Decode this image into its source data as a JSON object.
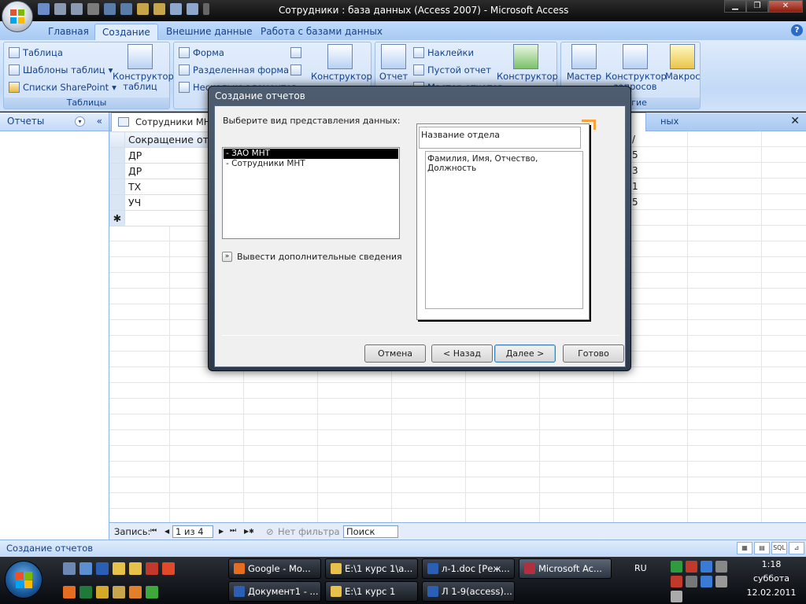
{
  "window": {
    "title": "Сотрудники : база данных (Access 2007) - Microsoft Access",
    "min_label": "▁",
    "max_label": "❐",
    "close_label": "✕"
  },
  "ribbon": {
    "tabs": [
      "Главная",
      "Создание",
      "Внешние данные",
      "Работа с базами данных"
    ],
    "active_tab": "Создание",
    "help_label": "?",
    "tables_group": {
      "title": "Таблицы",
      "table": "Таблица",
      "templates": "Шаблоны таблиц",
      "sharepoint": "Списки SharePoint",
      "designer_line1": "Конструктор",
      "designer_line2": "таблиц"
    },
    "forms_group": {
      "form": "Форма",
      "split_form": "Разделенная форма",
      "multi_items": "Несколько элементов",
      "designer": "Конструктор"
    },
    "reports_group": {
      "report": "Отчет",
      "labels": "Наклейки",
      "blank_report": "Пустой отчет",
      "wizard": "Мастер отчетов",
      "designer": "Конструктор"
    },
    "other_group": {
      "title": "Другие",
      "wizard": "Мастер",
      "query_designer_line1": "Конструктор",
      "query_designer_line2": "запросов",
      "macro": "Макрос"
    }
  },
  "nav": {
    "title": "Отчеты",
    "dropdown": "▾",
    "collapse": "«"
  },
  "document": {
    "tab_title": "Сотрудники МНТ",
    "right_tab_fragment": "ных",
    "close": "✕",
    "column_header": "Сокращение от",
    "rows": [
      "ДР",
      "ДР",
      "ТХ",
      "УЧ"
    ],
    "new_row_marker": "✱",
    "right_digits": [
      "5",
      "3",
      "1",
      "5"
    ],
    "right_header_fragment": "/"
  },
  "record_nav": {
    "label": "Запись:",
    "first": "⏮",
    "prev": "◀",
    "position": "1 из 4",
    "next": "▶",
    "last": "⏭",
    "new": "▶✱",
    "filter": "Нет фильтра",
    "search_placeholder": "Поиск"
  },
  "status": {
    "text": "Создание отчетов",
    "views": [
      "▦",
      "▤",
      "SQL",
      "⊿"
    ]
  },
  "dialog": {
    "title": "Создание отчетов",
    "prompt": "Выберите вид представления данных:",
    "list": [
      "- ЗАО МНТ",
      "- Сотрудники МНТ"
    ],
    "selected_index": 0,
    "more_info": "Вывести дополнительные сведения",
    "more_chevron": "»",
    "preview_header": "Название отдела",
    "preview_body": "Фамилия, Имя, Отчество, Должность",
    "buttons": {
      "cancel": "Отмена",
      "back": "< Назад",
      "next": "Далее >",
      "finish": "Готово"
    }
  },
  "taskbar": {
    "tasks_row1": [
      "Google - Mo...",
      "E:\\1 курс 1\\а...",
      "л-1.doc [Реж...",
      "Microsoft Ac..."
    ],
    "tasks_row2": [
      "Документ1 - ...",
      "E:\\1 курс 1",
      "Л 1-9(access)..."
    ],
    "active_task": "Microsoft Ac...",
    "lang": "RU",
    "time": "1:18",
    "weekday": "суббота",
    "date": "12.02.2011"
  },
  "colors": {
    "ribbon_text": "#15428b",
    "selected_list_bg": "#000000",
    "preview_mark": "#f7a23b"
  }
}
